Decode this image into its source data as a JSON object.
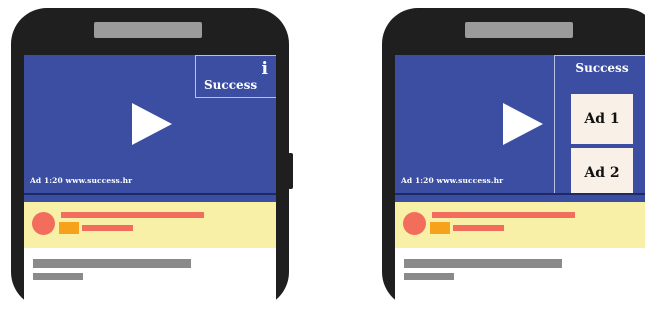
{
  "left_phone": {
    "ad_caption": "Ad 1:20 www.success.hr",
    "overlay_title": "Success",
    "info_glyph": "i"
  },
  "right_phone": {
    "ad_caption": "Ad 1:20 www.success.hr",
    "panel_title": "Success",
    "ads": [
      "Ad 1",
      "Ad 2"
    ]
  },
  "colors": {
    "video_bg": "#3b4ea2",
    "banner_bg": "#f7f0a6",
    "accent_red": "#f26d5b",
    "accent_orange": "#f6a21d",
    "placeholder_gray": "#8a8a8a",
    "phone_body": "#1f1f1f"
  },
  "icons": [
    "play-icon",
    "info-icon"
  ]
}
